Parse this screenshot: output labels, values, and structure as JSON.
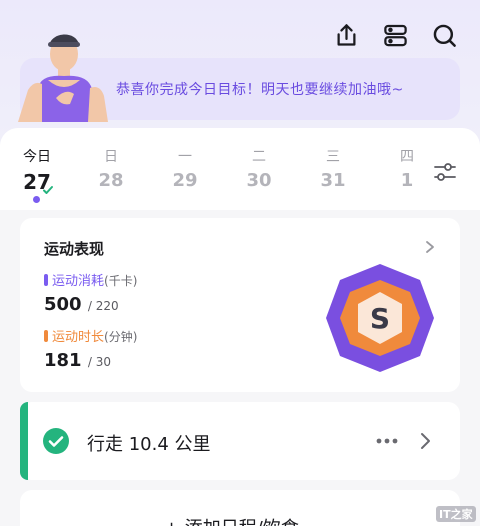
{
  "header": {
    "icons": [
      "share-icon",
      "devices-icon",
      "search-icon"
    ]
  },
  "banner": {
    "message": "恭喜你完成今日目标！明天也要继续加油哦~"
  },
  "date_strip": {
    "days": [
      {
        "weekday": "今日",
        "date": "27",
        "active": true
      },
      {
        "weekday": "日",
        "date": "28"
      },
      {
        "weekday": "一",
        "date": "29"
      },
      {
        "weekday": "二",
        "date": "30"
      },
      {
        "weekday": "三",
        "date": "31"
      },
      {
        "weekday": "四",
        "date": "1"
      }
    ]
  },
  "performance": {
    "title": "运动表现",
    "calories": {
      "label": "运动消耗",
      "unit": "(千卡)",
      "value": "500",
      "goal": "/ 220",
      "color": "#7a5cf0"
    },
    "duration": {
      "label": "运动时长",
      "unit": "(分钟)",
      "value": "181",
      "goal": "/ 30",
      "color": "#f08a3c"
    },
    "badge_letter": "S"
  },
  "activity": {
    "text": "行走 10.4 公里",
    "accent_color": "#24b47e"
  },
  "add": {
    "label": "+ 添加日程/饮食"
  },
  "watermark": "IT之家"
}
